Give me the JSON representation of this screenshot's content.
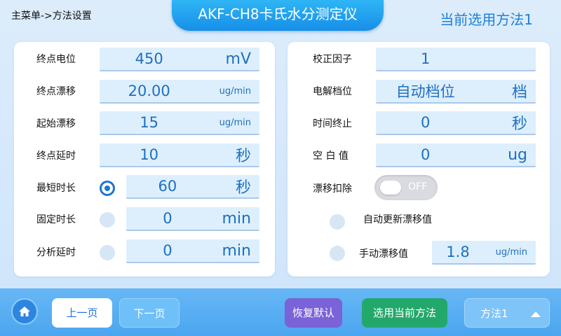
{
  "header": {
    "breadcrumb": "主菜单->方法设置",
    "title": "AKF-CH8卡氏水分测定仪",
    "current_method": "当前选用方法1"
  },
  "left": {
    "endpoint_potential": {
      "label": "终点电位",
      "value": "450",
      "unit": "mV"
    },
    "endpoint_drift": {
      "label": "终点漂移",
      "value": "20.00",
      "unit": "ug/min"
    },
    "start_drift": {
      "label": "起始漂移",
      "value": "15",
      "unit": "ug/min"
    },
    "endpoint_delay": {
      "label": "终点延时",
      "value": "10",
      "unit": "秒"
    },
    "min_duration": {
      "label": "最短时长",
      "value": "60",
      "unit": "秒",
      "selected": true
    },
    "fixed_duration": {
      "label": "固定时长",
      "value": "0",
      "unit": "min",
      "selected": false
    },
    "analysis_delay": {
      "label": "分析延时",
      "value": "0",
      "unit": "min",
      "selected": false
    }
  },
  "right": {
    "correction_factor": {
      "label": "校正因子",
      "value": "1"
    },
    "electrolysis_level": {
      "label": "电解档位",
      "value": "自动档位",
      "unit": "档"
    },
    "time_stop": {
      "label": "时间终止",
      "value": "0",
      "unit": "秒"
    },
    "blank_value": {
      "label": "空 白 值",
      "value": "0",
      "unit": "ug"
    },
    "drift_deduct": {
      "label": "漂移扣除",
      "toggle_text": "OFF",
      "on": false
    },
    "auto_update_drift": {
      "label": "自动更新漂移值",
      "selected": false
    },
    "manual_drift": {
      "label": "手动漂移值",
      "value": "1.8",
      "unit": "ug/min",
      "selected": false
    }
  },
  "bottom": {
    "prev": "上一页",
    "next": "下一页",
    "restore": "恢复默认",
    "use_current": "选用当前方法",
    "method_select": "方法1"
  },
  "colors": {
    "accent": "#1e74d8",
    "field_bg": "#ddeffd",
    "bar": "#4ba6ef",
    "purple": "#7a62d8",
    "green": "#23a86b"
  }
}
